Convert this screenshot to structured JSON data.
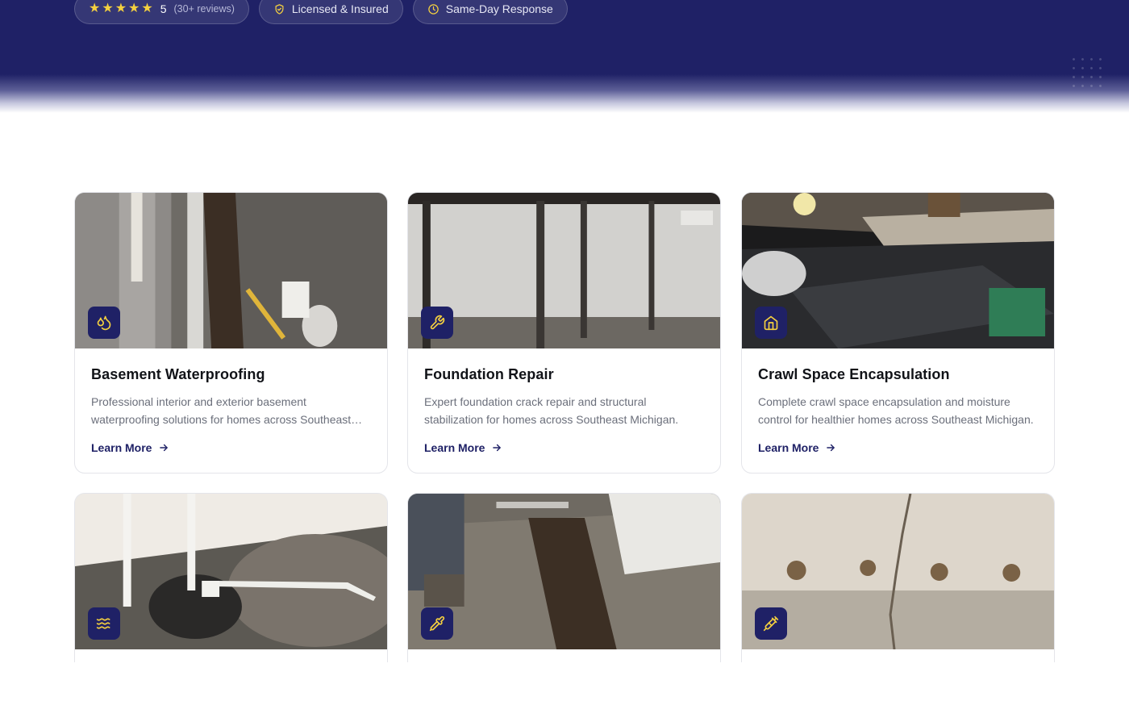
{
  "hero": {
    "badges": [
      {
        "rating": "5",
        "reviews": "(30+ reviews)",
        "stars": 5,
        "icon": "star-icon"
      },
      {
        "label": "Licensed & Insured",
        "icon": "shield-check-icon"
      },
      {
        "label": "Same-Day Response",
        "icon": "clock-icon"
      }
    ]
  },
  "services": [
    {
      "title": "Basement Waterproofing",
      "description": "Professional interior and exterior basement waterproofing solutions for homes across Southeast Michigan.",
      "link": "Learn More",
      "icon": "droplets-icon"
    },
    {
      "title": "Foundation Repair",
      "description": "Expert foundation crack repair and structural stabilization for homes across Southeast Michigan.",
      "link": "Learn More",
      "icon": "wrench-icon"
    },
    {
      "title": "Crawl Space Encapsulation",
      "description": "Complete crawl space encapsulation and moisture control for healthier homes across Southeast Michigan.",
      "link": "Learn More",
      "icon": "home-icon"
    },
    {
      "icon": "waves-icon"
    },
    {
      "icon": "pipette-icon"
    },
    {
      "icon": "syringe-icon"
    }
  ],
  "colors": {
    "navy": "#1f2166",
    "accent": "#f4d03f",
    "text": "#111318",
    "muted": "#6b6f7b"
  }
}
